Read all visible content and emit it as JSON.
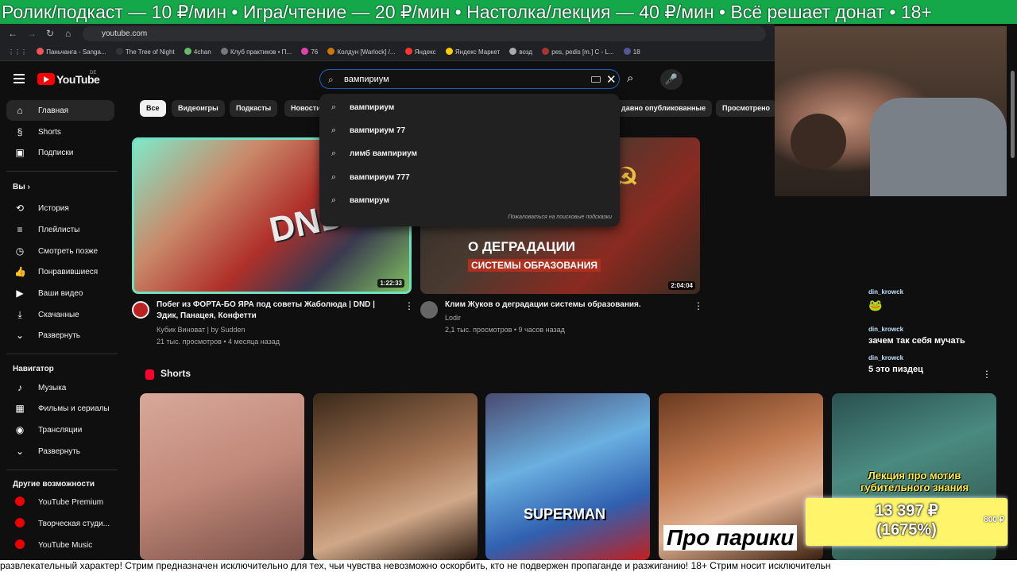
{
  "stream": {
    "top_ticker": "Ролик/подкаст — 10 ₽/мин • Игра/чтение — 20 ₽/мин • Настолка/лекция — 40 ₽/мин • Всё решает донат • 18+",
    "bottom_ticker": "развлекательный характер! Стрим предназначен исключительно для тех, чьи чувства невозможно оскорбить, кто не подвержен пропаганде и разжиганию! 18+ Стрим носит исключительн"
  },
  "browser": {
    "url": "youtube.com",
    "bookmarks": [
      "Паньчанга - Sanga...",
      "The Tree of Night",
      "4chan",
      "Клуб практиков • П...",
      "76",
      "Колдун [Warlock] /...",
      "Яндекс",
      "Яндекс Маркет",
      "возд",
      "pes, pedis [m.] C - L...",
      "18"
    ]
  },
  "header": {
    "logo_text": "YouTube",
    "region": "DE",
    "search_value": "вампириум"
  },
  "sidebar": {
    "main": [
      {
        "label": "Главная",
        "icon": "home-icon"
      },
      {
        "label": "Shorts",
        "icon": "shorts-icon"
      },
      {
        "label": "Подписки",
        "icon": "subscriptions-icon"
      }
    ],
    "you_title": "Вы",
    "you": [
      {
        "label": "История",
        "icon": "history-icon"
      },
      {
        "label": "Плейлисты",
        "icon": "playlists-icon"
      },
      {
        "label": "Смотреть позже",
        "icon": "watch-later-icon"
      },
      {
        "label": "Понравившиеся",
        "icon": "like-icon"
      },
      {
        "label": "Ваши видео",
        "icon": "your-videos-icon"
      },
      {
        "label": "Скачанные",
        "icon": "downloads-icon"
      },
      {
        "label": "Развернуть",
        "icon": "chevron-down-icon"
      }
    ],
    "nav_title": "Навигатор",
    "nav": [
      {
        "label": "Музыка",
        "icon": "music-icon"
      },
      {
        "label": "Фильмы и сериалы",
        "icon": "movies-icon"
      },
      {
        "label": "Трансляции",
        "icon": "live-icon"
      },
      {
        "label": "Развернуть",
        "icon": "chevron-down-icon"
      }
    ],
    "more_title": "Другие возможности",
    "more": [
      {
        "label": "YouTube Premium",
        "icon": "youtube-premium-icon"
      },
      {
        "label": "Творческая студи...",
        "icon": "youtube-studio-icon"
      },
      {
        "label": "YouTube Music",
        "icon": "youtube-music-icon"
      }
    ]
  },
  "chips": [
    "Все",
    "Видеоигры",
    "Подкасты",
    "Новости",
    "давно опубликованные",
    "Просмотрено"
  ],
  "suggestions": [
    "вампириум",
    "вампириум 77",
    "лимб вампириум",
    "вампириум 777",
    "вампирум"
  ],
  "report_label": "Пожаловаться на поисковые подсказки",
  "videos": [
    {
      "title_line1": "Побег из ФОРТА-БО ЯРА под советы Жаболюда | DND |",
      "title_line2": "Эдик, Панацея, Конфетти",
      "channel": "Кубик Виноват | by Sudden",
      "stats": "21 тыс. просмотров • 4 месяца назад",
      "duration": "1:22:33",
      "thumb_text": "DND"
    },
    {
      "title_line1": "Клим Жуков о деградации системы образования.",
      "title_line2": "",
      "channel": "Lodir",
      "stats": "2,1 тыс. просмотров • 9 часов назад",
      "duration": "2:04:04",
      "thumb_text_1": "О ДЕГРАДАЦИИ",
      "thumb_text_2": "СИСТЕМЫ ОБРАЗОВАНИЯ"
    }
  ],
  "shorts": {
    "title": "Shorts",
    "items": [
      {
        "overlay": ""
      },
      {
        "overlay": ""
      },
      {
        "overlay": "SUPERMAN"
      },
      {
        "overlay": "Про парики"
      },
      {
        "overlay": "Лекция про мотив губительного знания"
      }
    ]
  },
  "chat": [
    {
      "user": "din_krowck",
      "message": "🐸"
    },
    {
      "user": "din_krowck",
      "message": "зачем так себя мучать"
    },
    {
      "user": "din_krowck",
      "message": "5 это пиздец"
    }
  ],
  "donation": {
    "amount": "13 397 ₽",
    "percent": "(1675%)",
    "goal": "800 ₽",
    "progress_fraction": 1.0
  },
  "colors": {
    "bg": "#0f0f0f",
    "yt_red": "#ff0000",
    "ticker_green": "#14a84a",
    "donation_yellow": "#fff46a"
  }
}
